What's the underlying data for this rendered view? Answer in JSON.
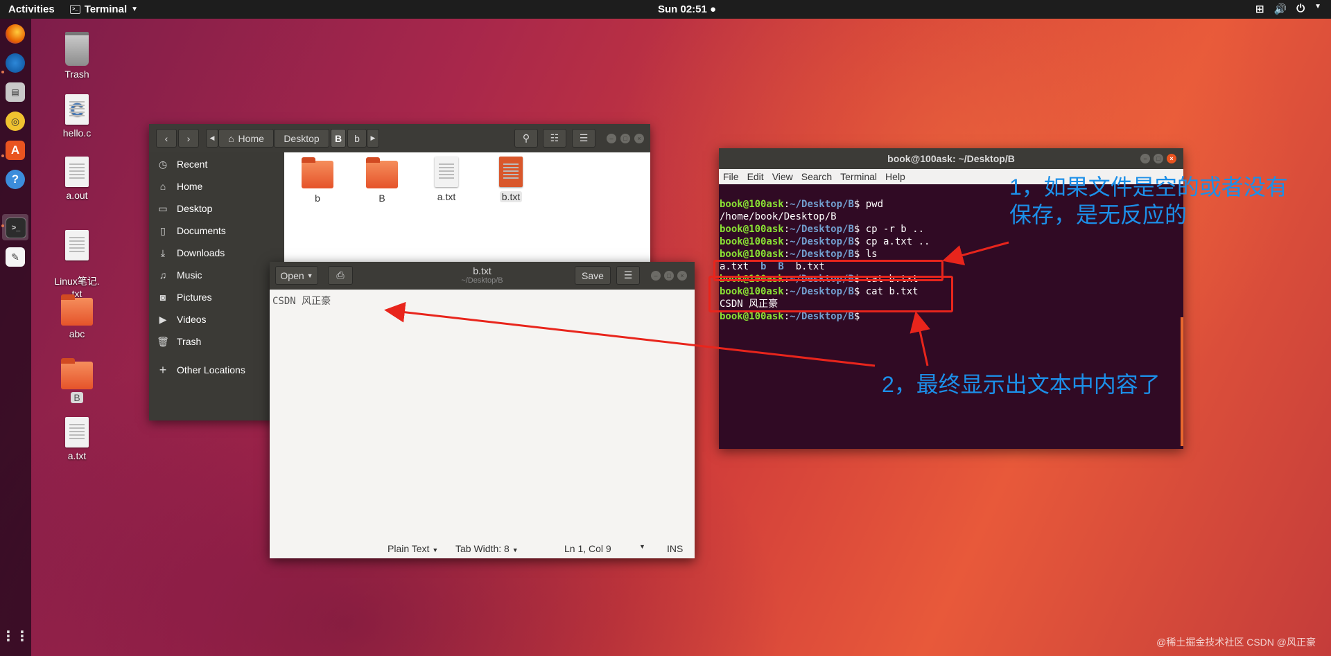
{
  "topbar": {
    "activities": "Activities",
    "app_name": "Terminal",
    "clock": "Sun 02:51 ●"
  },
  "desktop_icons": [
    {
      "label": "Trash"
    },
    {
      "label": "hello.c"
    },
    {
      "label": "a.out"
    },
    {
      "label": "Linux笔记.\ntxt"
    },
    {
      "label": "abc"
    },
    {
      "label": "B"
    },
    {
      "label": "a.txt"
    }
  ],
  "files": {
    "path": [
      "Home",
      "Desktop",
      "B",
      "b"
    ],
    "sidebar": [
      {
        "icon": "clock-icon",
        "label": "Recent"
      },
      {
        "icon": "home-icon",
        "label": "Home"
      },
      {
        "icon": "folder-icon",
        "label": "Desktop"
      },
      {
        "icon": "document-icon",
        "label": "Documents"
      },
      {
        "icon": "download-icon",
        "label": "Downloads"
      },
      {
        "icon": "music-icon",
        "label": "Music"
      },
      {
        "icon": "camera-icon",
        "label": "Pictures"
      },
      {
        "icon": "video-icon",
        "label": "Videos"
      },
      {
        "icon": "trash-icon",
        "label": "Trash"
      },
      {
        "icon": "plus-icon",
        "label": "Other Locations"
      }
    ],
    "items": [
      {
        "name": "b",
        "type": "folder"
      },
      {
        "name": "B",
        "type": "folder"
      },
      {
        "name": "a.txt",
        "type": "text"
      },
      {
        "name": "b.txt",
        "type": "text-orange"
      }
    ]
  },
  "gedit": {
    "open_label": "Open",
    "title": "b.txt",
    "subtitle": "~/Desktop/B",
    "save_label": "Save",
    "content": "CSDN 风正豪",
    "status": {
      "syntax": "Plain Text",
      "tab_width": "Tab Width: 8",
      "position": "Ln 1, Col 9",
      "mode": "INS"
    }
  },
  "terminal": {
    "title": "book@100ask: ~/Desktop/B",
    "menu": [
      "File",
      "Edit",
      "View",
      "Search",
      "Terminal",
      "Help"
    ],
    "user": "book@100ask",
    "cwd": "~/Desktop/B",
    "commands": {
      "c1": "pwd",
      "o1": "/home/book/Desktop/B",
      "c2": "cp -r b ..",
      "c3": "cp a.txt ..",
      "c4": "ls",
      "ls_a": "a.txt",
      "ls_b1": "b",
      "ls_b2": "B",
      "ls_c": "b.txt",
      "c5": "cat b.txt",
      "c6": "cat b.txt",
      "o6": "CSDN 风正豪"
    }
  },
  "annotations": {
    "note1_line1": "1，如果文件是空的或者没有",
    "note1_line2": "保存，是无反应的",
    "note2": "2，最终显示出文本中内容了",
    "color": "#1c8fe8",
    "box_color": "#e8251c"
  },
  "watermark": "@稀土掘金技术社区  CSDN @风正豪",
  "colors": {
    "accent": "#e95420",
    "term_bg": "#300a24",
    "prompt_user": "#8ae234",
    "prompt_path": "#729fcf"
  }
}
